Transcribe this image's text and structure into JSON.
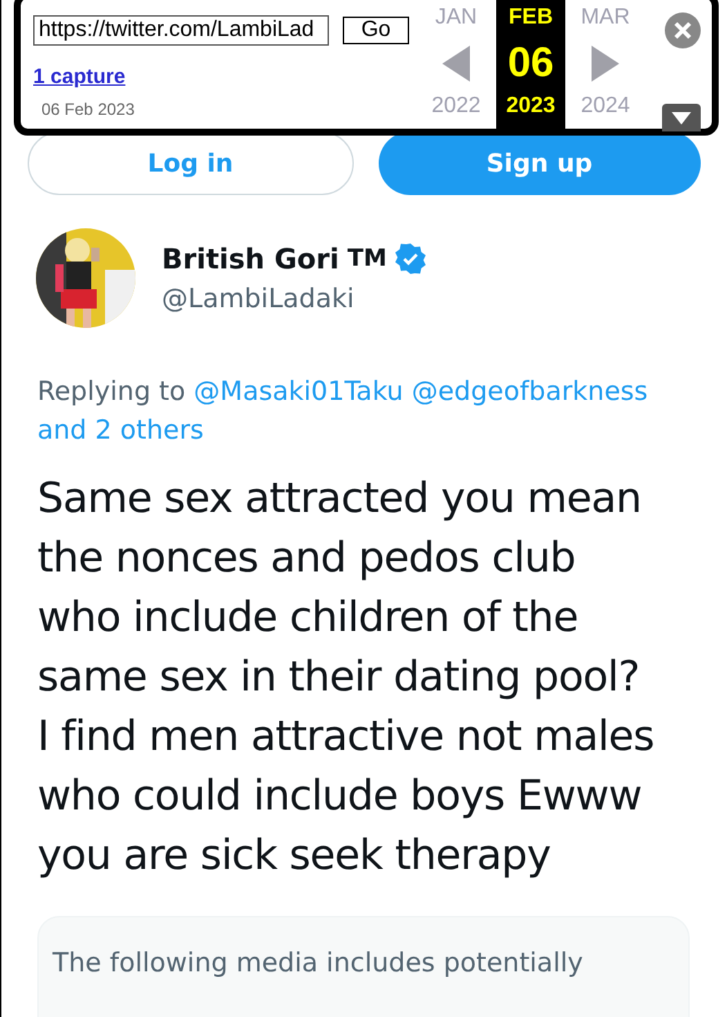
{
  "wayback_toolbar": {
    "url": "https://twitter.com/LambiLad",
    "go_button": "Go",
    "captures_link": "1 capture",
    "capture_date": "06 Feb 2023",
    "months": [
      {
        "month": "JAN",
        "year": "2022",
        "selected": false
      },
      {
        "month": "FEB",
        "day": "06",
        "year": "2023",
        "selected": true
      },
      {
        "month": "MAR",
        "year": "2024",
        "selected": false
      }
    ]
  },
  "auth_buttons": [
    {
      "label": "Log in",
      "kind": "outline"
    },
    {
      "label": "Sign up",
      "kind": "filled"
    }
  ],
  "tweet": {
    "author": {
      "name": "British Gori",
      "suffix": "TM",
      "verified": true,
      "handle": "@LambiLadaki"
    },
    "replying_to": {
      "prefix": "Replying to",
      "mentions": [
        "@Masaki01Taku",
        "@edgeofbarkness"
      ],
      "others": "and 2 others"
    },
    "text": "Same sex attracted you mean the nonces and pedos club who include children of the same sex in their dating pool? I find men attractive not males who could include boys Ewww you are sick seek therapy",
    "media_notice": "The following media includes potentially"
  }
}
